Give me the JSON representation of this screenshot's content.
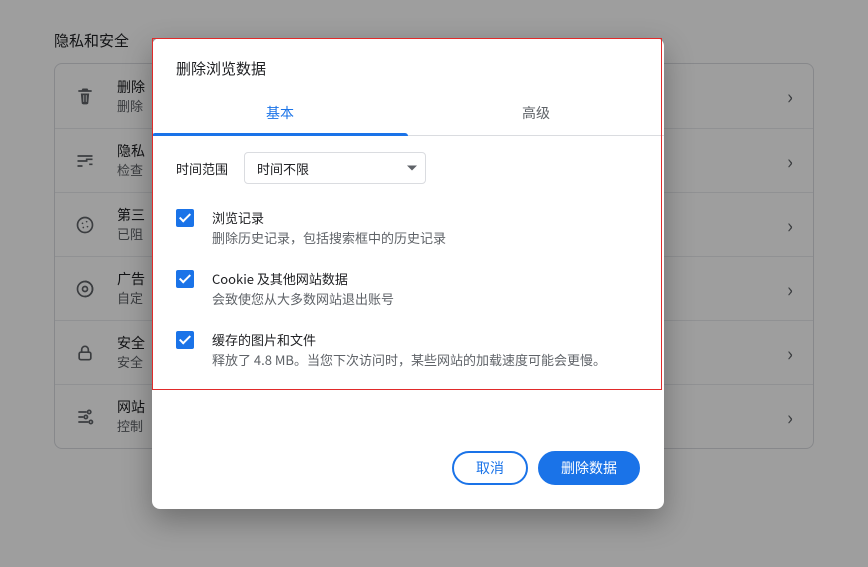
{
  "section_title": "隐私和安全",
  "rows": [
    {
      "title": "删除",
      "sub": "删除"
    },
    {
      "title": "隐私",
      "sub": "检查"
    },
    {
      "title": "第三",
      "sub": "已阻"
    },
    {
      "title": "广告",
      "sub": "自定"
    },
    {
      "title": "安全",
      "sub": "安全"
    },
    {
      "title": "网站",
      "sub": "控制"
    }
  ],
  "dialog": {
    "title": "删除浏览数据",
    "tabs": {
      "basic": "基本",
      "advanced": "高级"
    },
    "range_label": "时间范围",
    "range_value": "时间不限",
    "options": [
      {
        "title": "浏览记录",
        "sub": "删除历史记录，包括搜索框中的历史记录"
      },
      {
        "title": "Cookie 及其他网站数据",
        "sub": "会致使您从大多数网站退出账号"
      },
      {
        "title": "缓存的图片和文件",
        "sub": "释放了 4.8 MB。当您下次访问时，某些网站的加载速度可能会更慢。"
      }
    ],
    "cancel": "取消",
    "confirm": "删除数据"
  }
}
